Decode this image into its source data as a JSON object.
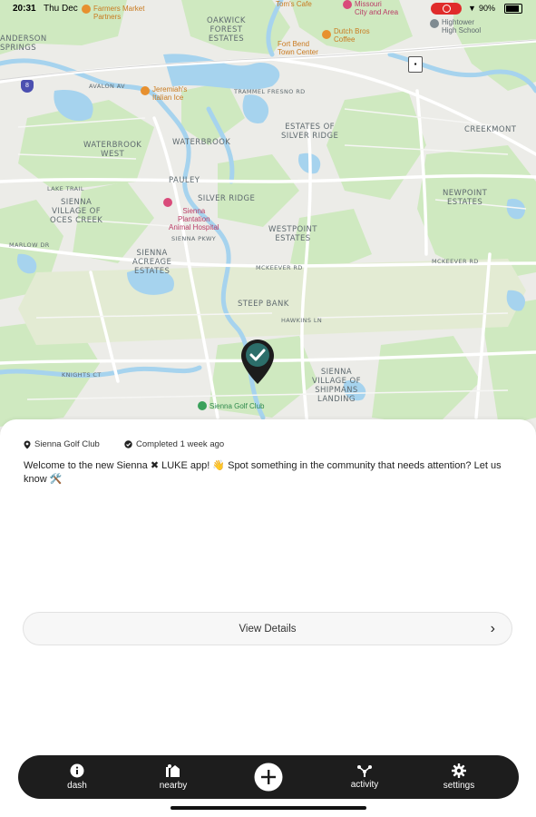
{
  "status_bar": {
    "time": "20:31",
    "date": "Thu Dec",
    "battery": "90%"
  },
  "map": {
    "neighborhoods": [
      {
        "id": "oakwick",
        "text": "OAKWICK\nFOREST\nESTATES"
      },
      {
        "id": "anderson",
        "text": "ANDERSON\nSPRINGS"
      },
      {
        "id": "waterbrook-west",
        "text": "WATERBROOK\nWEST"
      },
      {
        "id": "waterbrook",
        "text": "WATERBROOK"
      },
      {
        "id": "estates-silver",
        "text": "ESTATES OF\nSILVER RIDGE"
      },
      {
        "id": "creekmont",
        "text": "CREEKMONT"
      },
      {
        "id": "pauley",
        "text": "PAULEY"
      },
      {
        "id": "silver-ridge",
        "text": "SILVER RIDGE"
      },
      {
        "id": "sienna-oc",
        "text": "SIENNA\nVILLAGE OF\nOCES CREEK"
      },
      {
        "id": "westpoint",
        "text": "WESTPOINT\nESTATES"
      },
      {
        "id": "newpoint",
        "text": "NEWPOINT\nESTATES"
      },
      {
        "id": "sienna-acreage",
        "text": "SIENNA\nACREAGE\nESTATES"
      },
      {
        "id": "steep-bank",
        "text": "STEEP BANK"
      },
      {
        "id": "sienna-shipmans",
        "text": "SIENNA\nVILLAGE OF\nSHIPMANS\nLANDING"
      }
    ],
    "roads": [
      {
        "id": "avalon",
        "text": "AVALON AV"
      },
      {
        "id": "trammel",
        "text": "TRAMMEL FRESNO RD"
      },
      {
        "id": "mcKeever",
        "text": "MCKEEVER RD"
      },
      {
        "id": "mcKeever2",
        "text": "MCKEEVER RD"
      },
      {
        "id": "lake",
        "text": "LAKE TRAIL"
      },
      {
        "id": "sienna-pkwy",
        "text": "SIENNA PKWY"
      },
      {
        "id": "knights",
        "text": "KNIGHTS CT"
      },
      {
        "id": "marlow",
        "text": "MARLOW DR"
      },
      {
        "id": "hawkins",
        "text": "HAWKINS LN"
      }
    ],
    "pois": {
      "farmers_market": "Farmers Market\nPartners",
      "fort_bend_town": "Fort Bend\nTown Center",
      "dutch_bros": "Dutch Bros\nCoffee",
      "missouri_city": "Missouri\nCity and Area",
      "tom_cafe": "Tom's Cafe",
      "hightower": "Hightower\nHigh School",
      "jeremiahs": "Jeremiah's\nItalian Ice",
      "sienna_animal": "Sienna\nPlantation\nAnimal Hospital",
      "sienna_golf": "Sienna Golf Club"
    },
    "highway_shield": "8"
  },
  "sheet": {
    "location": "Sienna Golf Club",
    "status": "Completed 1 week ago",
    "message": "Welcome to the new Sienna ✖ LUKE app! 👋 Spot something in the community that needs attention? Let us know 🛠️",
    "view_details": "View Details"
  },
  "nav": {
    "items": [
      {
        "id": "dash",
        "label": "dash",
        "icon": "info-icon"
      },
      {
        "id": "nearby",
        "label": "nearby",
        "icon": "nearby-icon"
      },
      {
        "id": "add",
        "label": "",
        "icon": "plus-icon"
      },
      {
        "id": "activity",
        "label": "activity",
        "icon": "activity-icon"
      },
      {
        "id": "settings",
        "label": "settings",
        "icon": "gear-icon"
      }
    ]
  },
  "colors": {
    "water": "#a6d3ee",
    "park": "#cfe9c0",
    "road": "#ffffff",
    "highway_area": "#e3ebd3",
    "pin": "#2c6e6a",
    "nav_bg": "#1d1d1d",
    "poi_orange": "#e7902f",
    "poi_pink": "#d94b7a",
    "poi_green": "#3aa15b"
  }
}
